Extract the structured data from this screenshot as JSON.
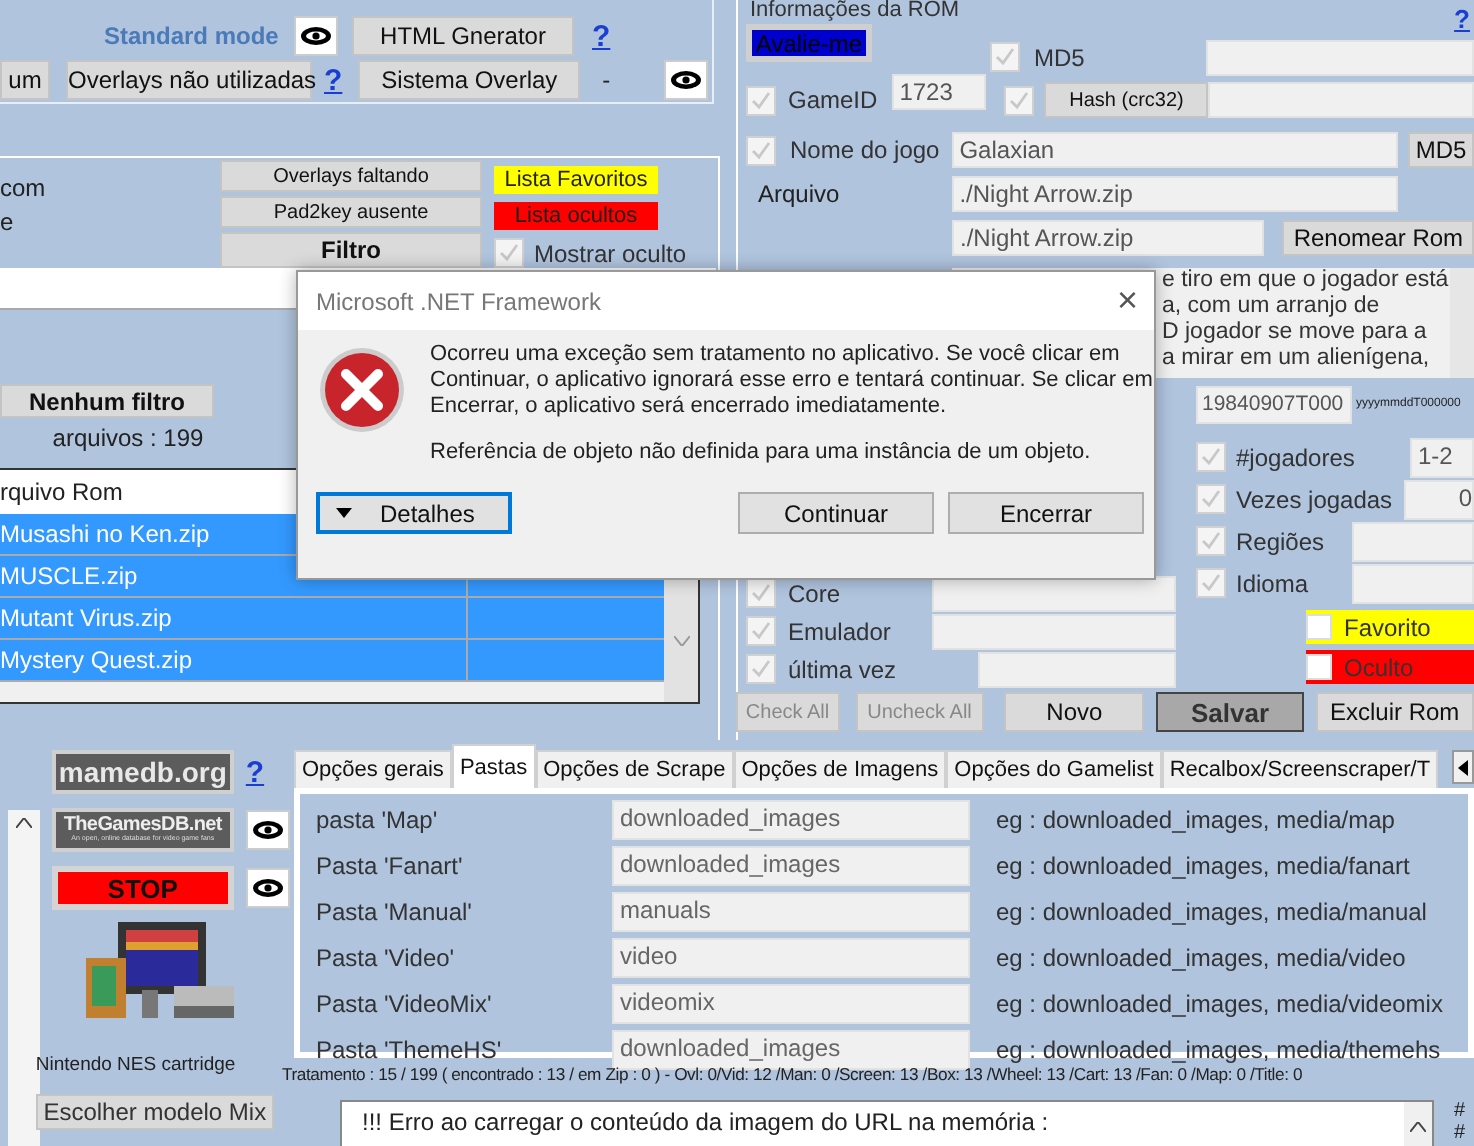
{
  "toolbar": {
    "mode_label": "Standard mode",
    "html_button": "HTML Gnerator",
    "help_top": "?",
    "partial_button": "um",
    "overlays_button": "Overlays não utilizadas",
    "help_middle": "?",
    "system_button": "Sistema Overlay",
    "dash": "-"
  },
  "filters": {
    "left_texts": [
      "com",
      "e"
    ],
    "buttons": [
      {
        "label": "Overlays faltando",
        "bold": false
      },
      {
        "label": "Pad2key ausente",
        "bold": false
      },
      {
        "label": "Filtro",
        "bold": true
      }
    ],
    "lists": [
      {
        "label": "Lista Favoritos",
        "color": "#ffff00"
      },
      {
        "label": "Lista ocultos",
        "color": "#ff0000"
      }
    ],
    "show_hidden": {
      "label": "Mostrar oculto",
      "checked": true
    },
    "no_filter_button": "Nenhum filtro",
    "file_count": "arquivos : 199"
  },
  "rom_list": {
    "column": "rquivo Rom",
    "rows": [
      {
        "name": "Musashi no Ken.zip",
        "selected": true
      },
      {
        "name": "MUSCLE.zip",
        "selected": true
      },
      {
        "name": "Mutant Virus.zip",
        "selected": true
      },
      {
        "name": "Mystery Quest.zip",
        "selected": true
      }
    ]
  },
  "rom_info": {
    "title": "Informações da ROM",
    "help": "?",
    "rate_button": "Avalie-me",
    "md5": {
      "label": "MD5",
      "checked": true
    },
    "game_id": {
      "label": "GameID",
      "checked": true,
      "value": "1723"
    },
    "hash": {
      "checked": true,
      "button": "Hash (crc32)"
    },
    "name": {
      "label": "Nome do jogo",
      "checked": true,
      "value": "Galaxian",
      "button": "MD5"
    },
    "file": {
      "label": "Arquivo",
      "value": "./Night Arrow.zip"
    },
    "rename": {
      "value": "./Night Arrow.zip",
      "button": "Renomear Rom"
    },
    "description_lines": [
      "e tiro em que o jogador está",
      "a, com um arranjo de",
      "D jogador se move para a",
      "a mirar em um alienígena,"
    ],
    "date": {
      "value": "19840907T000",
      "hint": "yyyymmddT000000"
    },
    "left_fields": [
      {
        "label": "Core",
        "checked": true
      },
      {
        "label": "Emulador",
        "checked": true
      },
      {
        "label": "última vez",
        "checked": true
      }
    ],
    "fields": [
      {
        "label": "#jogadores",
        "checked": true,
        "value": "1-2"
      },
      {
        "label": "Vezes jogadas",
        "checked": true,
        "value": "0"
      },
      {
        "label": "Regiões",
        "checked": true
      },
      {
        "label": "Idioma",
        "checked": true
      }
    ],
    "flags": [
      {
        "label": "Favorito",
        "checked": false,
        "color": "#ffff00"
      },
      {
        "label": "Oculto",
        "checked": false,
        "color": "#ff0000"
      }
    ],
    "actions": [
      {
        "label": "Check All",
        "kind": "disabled"
      },
      {
        "label": "Uncheck All",
        "kind": "disabled"
      },
      {
        "label": "Novo",
        "kind": "normal"
      },
      {
        "label": "Salvar",
        "kind": "primary"
      },
      {
        "label": "Excluir Rom",
        "kind": "normal"
      }
    ]
  },
  "sources": {
    "mamedb_logo": "mamedb.org",
    "help": "?",
    "gamesdb_logo": "TheGamesDB.net",
    "gamesdb_tagline": "An open, online database for video game fans",
    "stop_button": "STOP",
    "caption": "Nintendo NES cartridge",
    "mix_button": "Escolher modelo Mix"
  },
  "tabs": [
    {
      "label": "Opções gerais",
      "selected": false
    },
    {
      "label": "Pastas",
      "selected": true
    },
    {
      "label": "Opções de Scrape",
      "selected": false
    },
    {
      "label": "Opções de Imagens",
      "selected": false
    },
    {
      "label": "Opções do Gamelist",
      "selected": false
    },
    {
      "label": "Recalbox/Screenscraper/T",
      "selected": false
    }
  ],
  "folders": [
    {
      "label": "pasta 'Map'",
      "value": "downloaded_images",
      "example": "eg : downloaded_images,  media/map"
    },
    {
      "label": "Pasta 'Fanart'",
      "value": "downloaded_images",
      "example": "eg : downloaded_images,  media/fanart"
    },
    {
      "label": "Pasta 'Manual'",
      "value": "manuals",
      "example": "eg : downloaded_images,  media/manual"
    },
    {
      "label": "Pasta 'Video'",
      "value": "video",
      "example": "eg : downloaded_images,  media/video"
    },
    {
      "label": "Pasta 'VideoMix'",
      "value": "videomix",
      "example": "eg : downloaded_images,  media/videomix"
    },
    {
      "label": "Pasta 'ThemeHS'",
      "value": "downloaded_images",
      "example": "eg : downloaded_images,  media/themehs"
    }
  ],
  "status_bar": "Tratamento : 15 / 199  ( encontrado : 13 / em Zip : 0 )   - Ovl: 0/Vid: 12 /Man: 0 /Screen: 13 /Box: 13 /Wheel: 13 /Cart: 13 /Fan: 0 /Map: 0 /Title: 0",
  "log": {
    "text": "!!! Erro ao carregar o conteúdo da imagem do URL na memória :",
    "side_marks": [
      "#",
      "#"
    ]
  },
  "dialog": {
    "title": "Microsoft .NET Framework",
    "close": "×",
    "message": "Ocorreu uma exceção sem tratamento no aplicativo. Se você clicar em Continuar, o aplicativo ignorará esse erro e tentará continuar. Se clicar em Encerrar, o aplicativo será encerrado imediatamente.",
    "detail": "Referência de objeto não definida para uma instância de um objeto.",
    "details_button": "Detalhes",
    "continue_button": "Continuar",
    "quit_button": "Encerrar"
  }
}
